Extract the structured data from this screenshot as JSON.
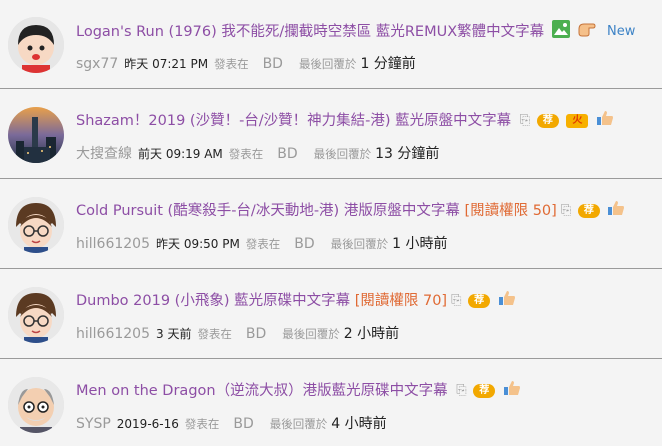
{
  "colors": {
    "title": "#8d4ea5",
    "permission": "#e06a34",
    "muted": "#9a9a9a",
    "new": "#3d83c6"
  },
  "posts": [
    {
      "title": "Logan's Run (1976) 我不能死/攔截時空禁區 藍光REMUX繁體中文字幕",
      "permission": "",
      "icons": [
        "image-icon",
        "hand-icon"
      ],
      "new_label": "New",
      "user": "sgx77",
      "date": "昨天 07:21 PM",
      "posted_label": "發表在",
      "board": "BD",
      "reply_label": "最後回覆於",
      "ago": "1 分鐘前"
    },
    {
      "title": "Shazam！2019 (沙贊！-台/沙贊！神力集結-港) 藍光原盤中文字幕",
      "permission": "",
      "icons": [
        "attachment-icon",
        "recommend-badge-icon",
        "hot-badge-icon",
        "thumbs-up-icon"
      ],
      "user": "大搜查線",
      "date": "前天 09:19 AM",
      "posted_label": "發表在",
      "board": "BD",
      "reply_label": "最後回覆於",
      "ago": "13 分鐘前"
    },
    {
      "title": "Cold Pursuit (酷寒殺手-台/冰天動地-港) 港版原盤中文字幕",
      "permission": "[閱讀權限 50]",
      "icons": [
        "attachment-icon",
        "recommend-badge-icon",
        "thumbs-up-icon"
      ],
      "user": "hill661205",
      "date": "昨天 09:50 PM",
      "posted_label": "發表在",
      "board": "BD",
      "reply_label": "最後回覆於",
      "ago": "1 小時前"
    },
    {
      "title": "Dumbo 2019 (小飛象) 藍光原碟中文字幕",
      "permission": "[閱讀權限 70]",
      "icons": [
        "attachment-icon",
        "recommend-badge-icon",
        "thumbs-up-icon"
      ],
      "user": "hill661205",
      "date": "3 天前",
      "posted_label": "發表在",
      "board": "BD",
      "reply_label": "最後回覆於",
      "ago": "2 小時前"
    },
    {
      "title": "Men on the Dragon（逆流大叔）港版藍光原碟中文字幕",
      "permission": "",
      "icons": [
        "attachment-icon",
        "recommend-badge-icon",
        "thumbs-up-icon"
      ],
      "user": "SYSP",
      "date": "2019-6-16",
      "posted_label": "發表在",
      "board": "BD",
      "reply_label": "最後回覆於",
      "ago": "4 小時前"
    }
  ],
  "badges": {
    "recommend": "荐",
    "hot": "火"
  }
}
